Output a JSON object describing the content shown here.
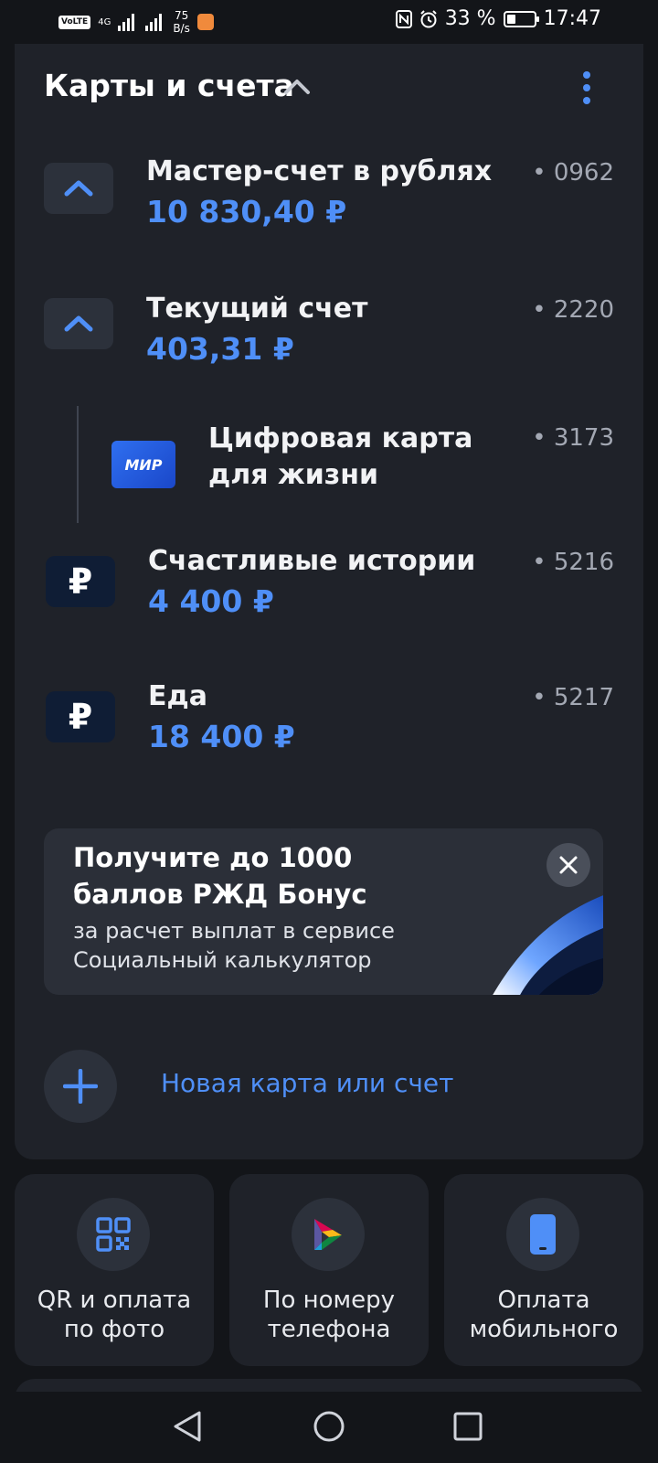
{
  "status_bar": {
    "network_badge": "VoLTE",
    "network_type": "4G",
    "speed_value": "75",
    "speed_unit": "B/s",
    "battery_percent": "33 %",
    "battery_level": 0.33,
    "time": "17:47"
  },
  "section": {
    "title": "Карты и счета"
  },
  "accounts": [
    {
      "name": "Мастер-счет в рублях",
      "amount": "10 830,40 ₽",
      "number": "• 0962",
      "icon": "chevron-up-icon"
    },
    {
      "name": "Текущий счет",
      "amount": "403,31 ₽",
      "number": "• 2220",
      "icon": "chevron-up-icon"
    },
    {
      "name": "Счастливые истории",
      "amount": "4 400 ₽",
      "number": "• 5216",
      "icon": "ruble-icon",
      "icon_glyph": "₽"
    },
    {
      "name": "Еда",
      "amount": "18 400 ₽",
      "number": "• 5217",
      "icon": "ruble-icon",
      "icon_glyph": "₽"
    }
  ],
  "card": {
    "name": "Цифровая карта для жизни",
    "number": "• 3173",
    "brand": "МИР"
  },
  "promo": {
    "title": "Получите до 1000 баллов РЖД Бонус",
    "subtitle": "за расчет выплат в сервисе Социальный калькулятор"
  },
  "add_new": {
    "label": "Новая карта или счет"
  },
  "actions": [
    {
      "label": "QR и оплата\nпо фото",
      "icon": "qr-code-icon"
    },
    {
      "label": "По номеру\nтелефона",
      "icon": "sbp-transfer-icon"
    },
    {
      "label": "Оплата\nмобильного",
      "icon": "mobile-phone-icon"
    }
  ],
  "colors": {
    "background": "#131519",
    "card": "#1f2229",
    "accent": "#4f8ff7",
    "text_secondary": "#a3a8b3"
  }
}
